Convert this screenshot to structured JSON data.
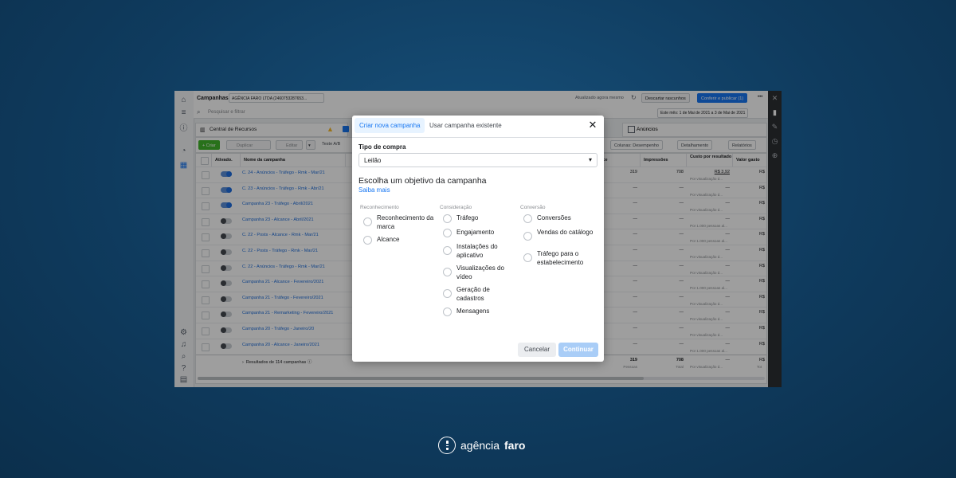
{
  "app": {
    "title": "Campanhas",
    "account": "AGÊNCIA FARO LTDA (2460753287653...",
    "updated": "Atualizado agora mesmo",
    "discard": "Descartar rascunhos",
    "review_publish": "Conferir e publicar (1)",
    "more": "•••",
    "search_placeholder": "Pesquisar e filtrar",
    "date_range": "Este mês: 1 de Mai de 2021 a 3 de Mai de 2021",
    "resource_center": "Central de Recursos",
    "ads_tab": "Anúncios"
  },
  "toolbar": {
    "create": "+ Criar",
    "duplicate": "Duplicar",
    "edit": "Editar",
    "ab_test": "Teste A/B",
    "columns": "Colunas: Desempenho",
    "breakdown": "Detalhamento",
    "reports": "Relatórios"
  },
  "table": {
    "headers": {
      "active": "Ativado.",
      "name": "Nome da campanha",
      "reach": "ance",
      "impressions": "Impressões",
      "cpr": "Custo por resultado",
      "spent": "Valor gasto"
    },
    "rows": [
      {
        "name": "C. 24 - Anúncios - Tráfego - Rmk - Mar/21",
        "on": true,
        "reach": "319",
        "impr": "708",
        "cpr": "R$ 3,92",
        "cpr_sub": "Por visualização d...",
        "spent": "R$"
      },
      {
        "name": "C. 23 - Anúncios - Tráfego - Rmk - Abr/21",
        "on": true,
        "reach": "—",
        "impr": "—",
        "cpr": "—",
        "cpr_sub": "Por visualização d...",
        "spent": "R$"
      },
      {
        "name": "Campanha 23 - Tráfego - Abril/2021",
        "on": true,
        "reach": "—",
        "impr": "—",
        "cpr": "—",
        "cpr_sub": "Por visualização d...",
        "spent": "R$"
      },
      {
        "name": "Campanha 23 - Alcance - Abril/2021",
        "on": false,
        "reach": "—",
        "impr": "—",
        "cpr": "—",
        "cpr_sub": "Por 1.000 pessoas al...",
        "spent": "R$"
      },
      {
        "name": "C. 22 - Posts - Alcance - Rmk - Mar/21",
        "on": false,
        "reach": "—",
        "impr": "—",
        "cpr": "—",
        "cpr_sub": "Por 1.000 pessoas al...",
        "spent": "R$"
      },
      {
        "name": "C. 22 - Posts - Tráfego - Rmk - Mar/21",
        "on": false,
        "reach": "—",
        "impr": "—",
        "cpr": "—",
        "cpr_sub": "Por visualização d...",
        "spent": "R$"
      },
      {
        "name": "C. 22 - Anúncios - Tráfego - Rmk - Mar/21",
        "on": false,
        "reach": "—",
        "impr": "—",
        "cpr": "—",
        "cpr_sub": "Por visualização d...",
        "spent": "R$"
      },
      {
        "name": "Campanha 21 - Alcance - Fevereiro/2021",
        "on": false,
        "reach": "—",
        "impr": "—",
        "cpr": "—",
        "cpr_sub": "Por 1.000 pessoas al...",
        "spent": "R$"
      },
      {
        "name": "Campanha 21 - Tráfego - Fevereiro/2021",
        "on": false,
        "reach": "—",
        "impr": "—",
        "cpr": "—",
        "cpr_sub": "Por visualização d...",
        "spent": "R$"
      },
      {
        "name": "Campanha 21 - Remarketing - Fevereiro/2021",
        "on": false,
        "reach": "—",
        "impr": "—",
        "cpr": "—",
        "cpr_sub": "Por visualização d...",
        "spent": "R$"
      },
      {
        "name": "Campanha 20 - Tráfego - Janeiro/20",
        "on": false,
        "reach": "—",
        "impr": "—",
        "cpr": "—",
        "cpr_sub": "Por visualização d...",
        "spent": "R$"
      },
      {
        "name": "Campanha 20 - Alcance - Janeiro/2021",
        "on": false,
        "reach": "—",
        "impr": "—",
        "cpr": "—",
        "cpr_sub": "Por 1.000 pessoas al...",
        "spent": "R$"
      }
    ],
    "footer": {
      "results": "Resultados de 114 campanhas",
      "reach": "319",
      "reach_sub": "Pessoas",
      "impr": "708",
      "impr_sub": "Total",
      "cpr": "—",
      "cpr_sub": "Por visualização d...",
      "spent": "R$",
      "spent_sub": "Tot"
    }
  },
  "modal": {
    "tab_new": "Criar nova campanha",
    "tab_existing": "Usar campanha existente",
    "close": "✕",
    "buying_type_label": "Tipo de compra",
    "buying_type_value": "Leilão",
    "objective_title": "Escolha um objetivo da campanha",
    "learn_more": "Saiba mais",
    "columns": [
      {
        "title": "Reconhecimento",
        "options": [
          "Reconhecimento da marca",
          "Alcance"
        ]
      },
      {
        "title": "Consideração",
        "options": [
          "Tráfego",
          "Engajamento",
          "Instalações do aplicativo",
          "Visualizações do vídeo",
          "Geração de cadastros",
          "Mensagens"
        ]
      },
      {
        "title": "Conversão",
        "options": [
          "Conversões",
          "Vendas do catálogo",
          "Tráfego para o estabelecimento"
        ]
      }
    ],
    "cancel": "Cancelar",
    "continue": "Continuar"
  },
  "brand": {
    "part1": "agência",
    "part2": "faro"
  }
}
